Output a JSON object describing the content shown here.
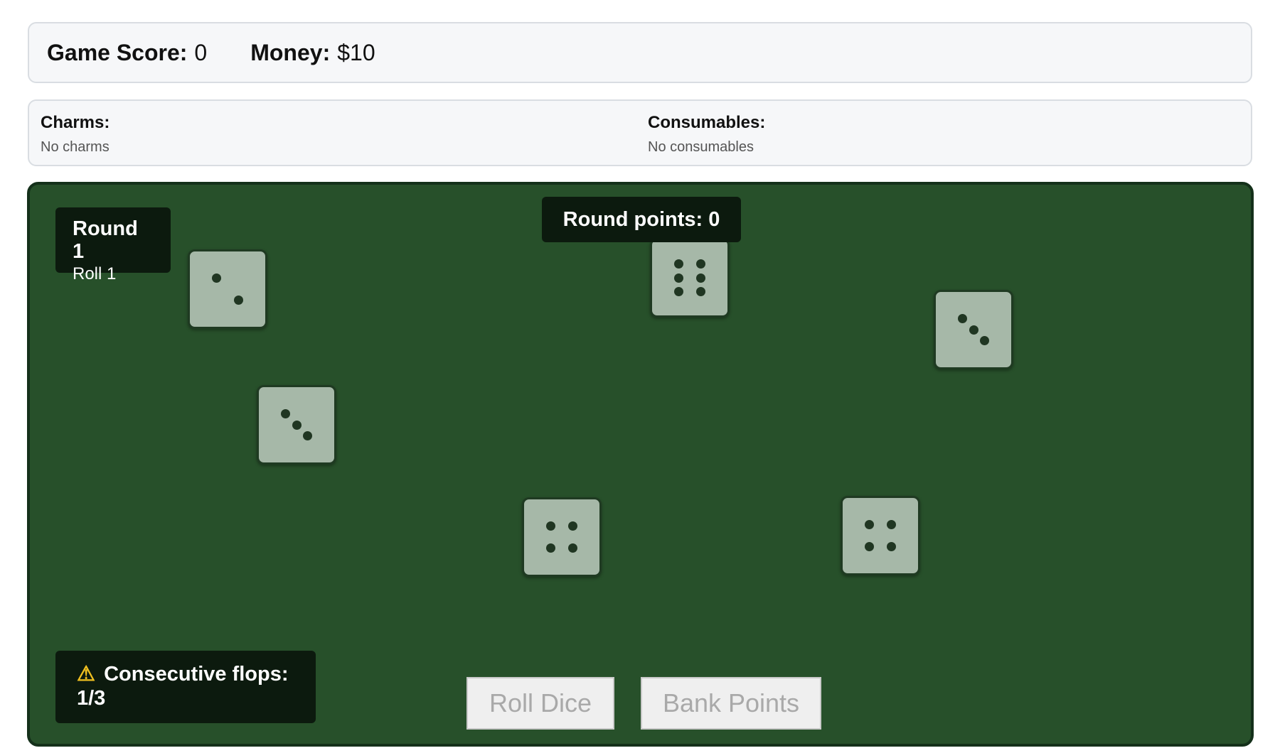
{
  "header": {
    "score_label": "Game Score:",
    "score_value": "0",
    "money_label": "Money:",
    "money_value": "$10"
  },
  "inventory": {
    "charms_title": "Charms:",
    "charms_empty": "No charms",
    "consumables_title": "Consumables:",
    "consumables_empty": "No consumables"
  },
  "table": {
    "round_title": "Round 1",
    "roll_text": "Roll 1",
    "round_points": "Round points: 0",
    "flops_icon": "⚠",
    "flops_text": "Consecutive flops:",
    "flops_value": "1/3"
  },
  "dice": [
    {
      "value": 2
    },
    {
      "value": 6
    },
    {
      "value": 3
    },
    {
      "value": 3
    },
    {
      "value": 4
    },
    {
      "value": 4
    }
  ],
  "buttons": {
    "roll": "Roll Dice",
    "bank": "Bank Points"
  },
  "colors": {
    "felt": "#27502a",
    "die_face": "#a6b8a8",
    "pip": "#203622",
    "panel": "#0c1a0e"
  }
}
